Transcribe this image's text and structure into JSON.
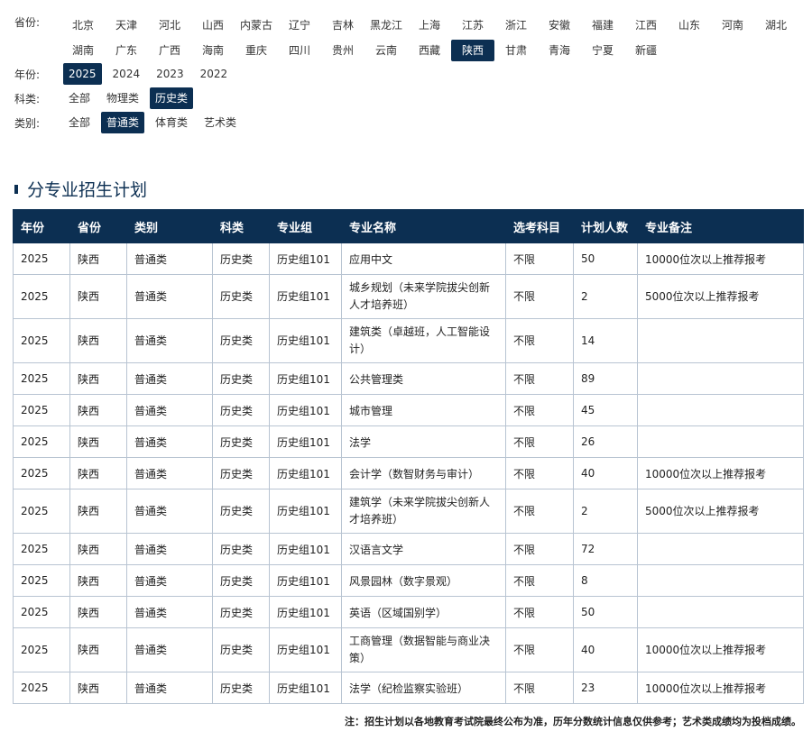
{
  "filters": {
    "province_label": "省份:",
    "provinces": [
      "北京",
      "天津",
      "河北",
      "山西",
      "内蒙古",
      "辽宁",
      "吉林",
      "黑龙江",
      "上海",
      "江苏",
      "浙江",
      "安徽",
      "福建",
      "江西",
      "山东",
      "河南",
      "湖北",
      "湖南",
      "广东",
      "广西",
      "海南",
      "重庆",
      "四川",
      "贵州",
      "云南",
      "西藏",
      "陕西",
      "甘肃",
      "青海",
      "宁夏",
      "新疆"
    ],
    "province_selected": "陕西",
    "year_label": "年份:",
    "years": [
      "2025",
      "2024",
      "2023",
      "2022"
    ],
    "year_selected": "2025",
    "subject_label": "科类:",
    "subjects": [
      "全部",
      "物理类",
      "历史类"
    ],
    "subject_selected": "历史类",
    "category_label": "类别:",
    "categories": [
      "全部",
      "普通类",
      "体育类",
      "艺术类"
    ],
    "category_selected": "普通类"
  },
  "section": {
    "title": "分专业招生计划"
  },
  "table": {
    "headers": [
      "年份",
      "省份",
      "类别",
      "科类",
      "专业组",
      "专业名称",
      "选考科目",
      "计划人数",
      "专业备注"
    ],
    "rows": [
      [
        "2025",
        "陕西",
        "普通类",
        "历史类",
        "历史组101",
        "应用中文",
        "不限",
        "50",
        "10000位次以上推荐报考"
      ],
      [
        "2025",
        "陕西",
        "普通类",
        "历史类",
        "历史组101",
        "城乡规划（未来学院拔尖创新人才培养班）",
        "不限",
        "2",
        "5000位次以上推荐报考"
      ],
      [
        "2025",
        "陕西",
        "普通类",
        "历史类",
        "历史组101",
        "建筑类（卓越班，人工智能设计）",
        "不限",
        "14",
        ""
      ],
      [
        "2025",
        "陕西",
        "普通类",
        "历史类",
        "历史组101",
        "公共管理类",
        "不限",
        "89",
        ""
      ],
      [
        "2025",
        "陕西",
        "普通类",
        "历史类",
        "历史组101",
        "城市管理",
        "不限",
        "45",
        ""
      ],
      [
        "2025",
        "陕西",
        "普通类",
        "历史类",
        "历史组101",
        "法学",
        "不限",
        "26",
        ""
      ],
      [
        "2025",
        "陕西",
        "普通类",
        "历史类",
        "历史组101",
        "会计学（数智财务与审计）",
        "不限",
        "40",
        "10000位次以上推荐报考"
      ],
      [
        "2025",
        "陕西",
        "普通类",
        "历史类",
        "历史组101",
        "建筑学（未来学院拔尖创新人才培养班）",
        "不限",
        "2",
        "5000位次以上推荐报考"
      ],
      [
        "2025",
        "陕西",
        "普通类",
        "历史类",
        "历史组101",
        "汉语言文学",
        "不限",
        "72",
        ""
      ],
      [
        "2025",
        "陕西",
        "普通类",
        "历史类",
        "历史组101",
        "风景园林（数字景观）",
        "不限",
        "8",
        ""
      ],
      [
        "2025",
        "陕西",
        "普通类",
        "历史类",
        "历史组101",
        "英语（区域国别学）",
        "不限",
        "50",
        ""
      ],
      [
        "2025",
        "陕西",
        "普通类",
        "历史类",
        "历史组101",
        "工商管理（数据智能与商业决策）",
        "不限",
        "40",
        "10000位次以上推荐报考"
      ],
      [
        "2025",
        "陕西",
        "普通类",
        "历史类",
        "历史组101",
        "法学（纪检监察实验班）",
        "不限",
        "23",
        "10000位次以上推荐报考"
      ]
    ]
  },
  "footnote": "注：招生计划以各地教育考试院最终公布为准，历年分数统计信息仅供参考；艺术类成绩均为投档成绩。",
  "colors": {
    "accent": "#0c2f52",
    "border": "#b8c4d2"
  }
}
